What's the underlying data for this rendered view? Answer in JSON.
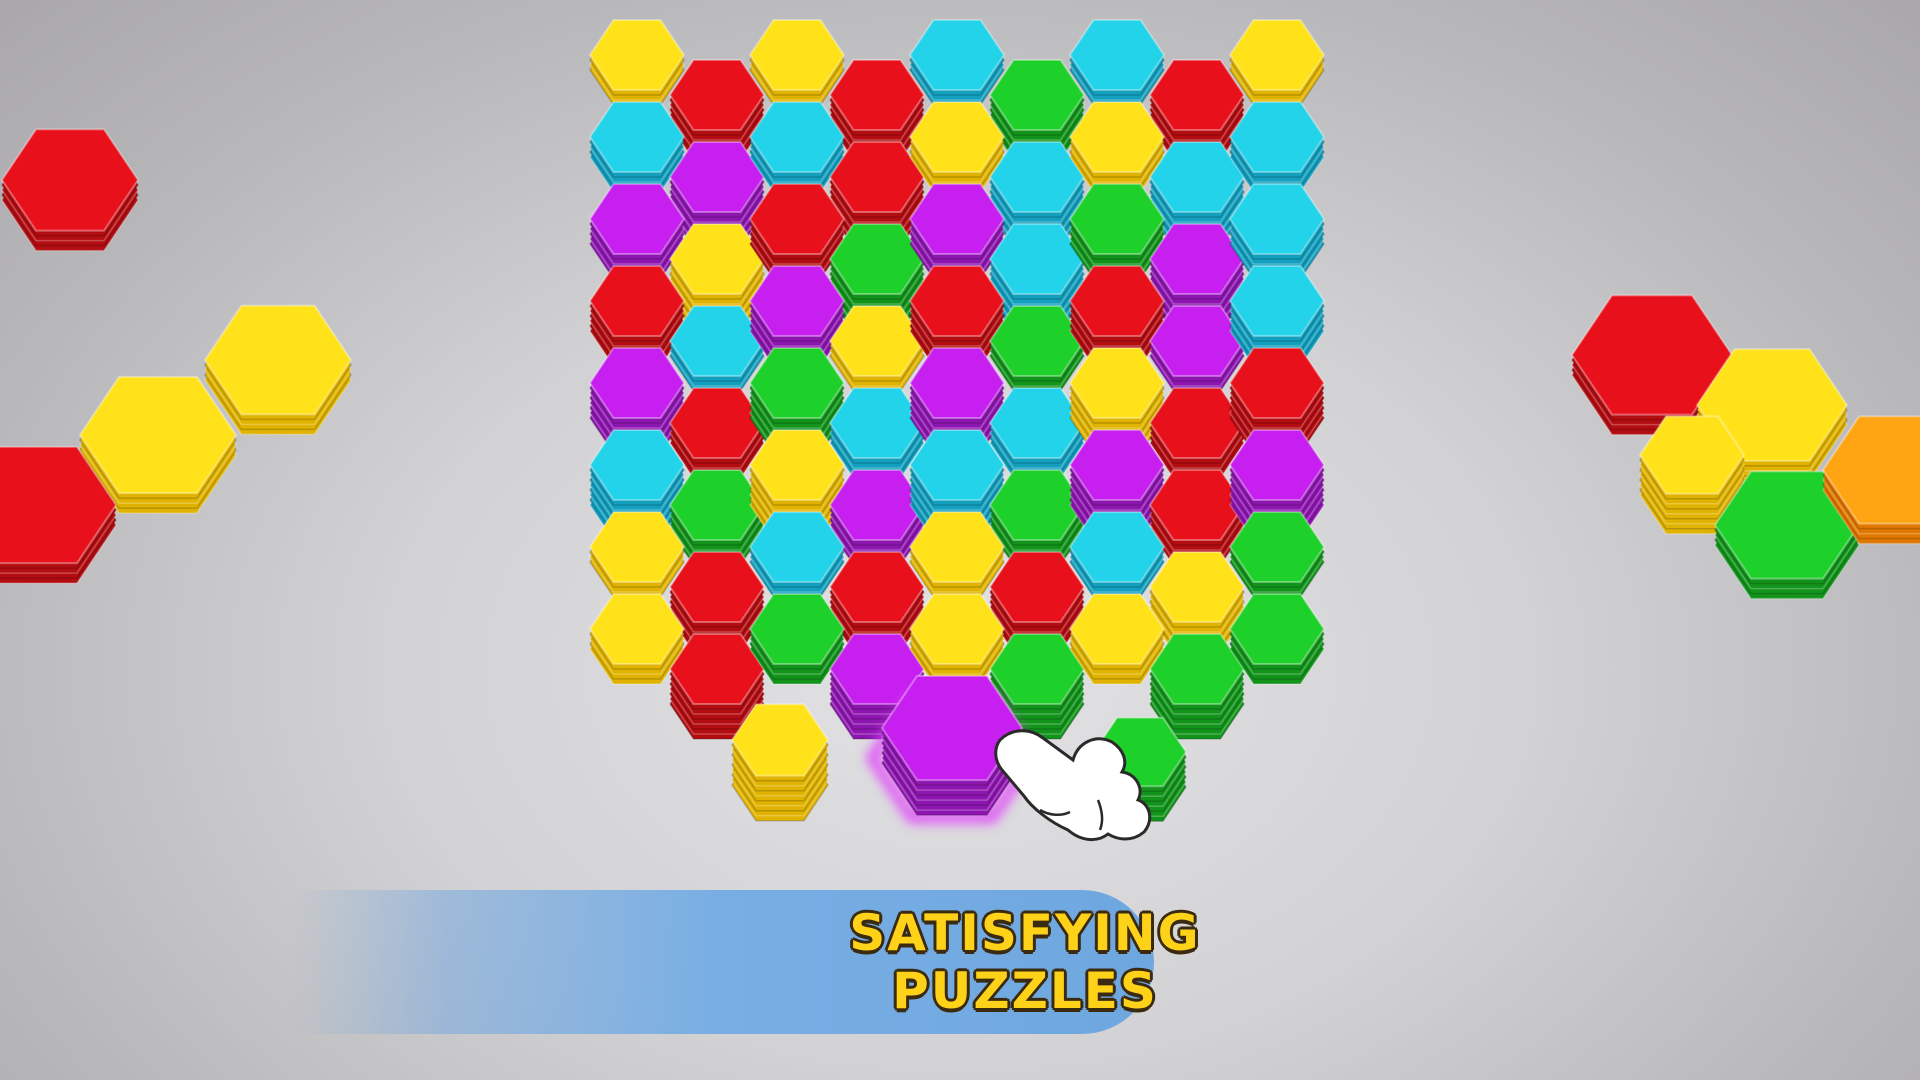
{
  "banner": {
    "line1": "SATISFYING",
    "line2": "PUZZLES"
  },
  "colors": {
    "red": {
      "top": "#e8101a",
      "side": "#b30d12"
    },
    "yellow": {
      "top": "#ffe21a",
      "side": "#e0b300"
    },
    "cyan": {
      "top": "#22d3ea",
      "side": "#139fbe"
    },
    "green": {
      "top": "#1ed12a",
      "side": "#12941b"
    },
    "purple": {
      "top": "#c71ff0",
      "side": "#8e16b0"
    },
    "banner_blue": "#77aee4",
    "banner_text": "#ffd21a",
    "selection_glow": "#e040fb"
  },
  "board": {
    "columns": 9,
    "rows": 8,
    "tiles": [
      [
        "yellow",
        "red",
        "yellow",
        "red",
        "cyan",
        "green",
        "cyan",
        "red",
        "yellow"
      ],
      [
        "cyan",
        "purple",
        "cyan",
        "red",
        "yellow",
        "cyan",
        "yellow",
        "cyan",
        "cyan"
      ],
      [
        "purple",
        "yellow",
        "red",
        "green",
        "purple",
        "cyan",
        "green",
        "purple",
        "cyan"
      ],
      [
        "red",
        "cyan",
        "purple",
        "yellow",
        "red",
        "green",
        "red",
        "purple",
        "cyan"
      ],
      [
        "purple",
        "red",
        "green",
        "cyan",
        "purple",
        "cyan",
        "yellow",
        "red",
        "red"
      ],
      [
        "cyan",
        "green",
        "yellow",
        "purple",
        "cyan",
        "green",
        "purple",
        "red",
        "purple"
      ],
      [
        "yellow",
        "red",
        "cyan",
        "red",
        "yellow",
        "red",
        "cyan",
        "yellow",
        "green"
      ],
      [
        "yellow",
        "red",
        "green",
        "purple",
        "yellow",
        "green",
        "yellow",
        "green",
        "green"
      ]
    ]
  },
  "tray": {
    "slots": [
      {
        "color": "yellow",
        "selected": false
      },
      {
        "color": "purple",
        "selected": true
      },
      {
        "color": "green",
        "selected": false
      }
    ],
    "hand_icon": "pointing-hand-icon"
  },
  "side_groups": {
    "left": [
      "red",
      "yellow",
      "yellow",
      "red"
    ],
    "right": [
      "red",
      "yellow",
      "yellow",
      "green",
      "orange"
    ]
  }
}
